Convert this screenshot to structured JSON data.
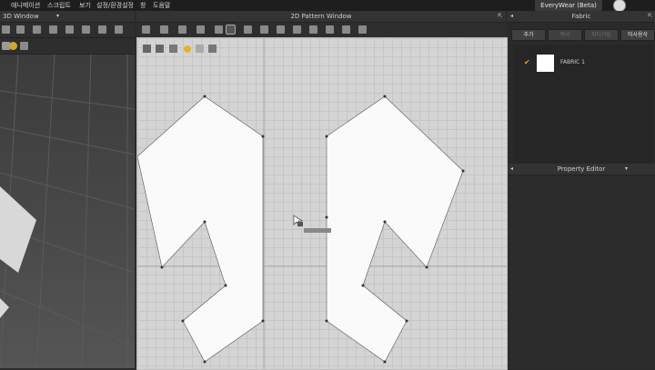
{
  "menubar": {
    "items": [
      "애니메이션",
      "스크립트",
      "보기",
      "설정/환경설정",
      "창",
      "도움말"
    ],
    "app_button": "EveryWear (Beta)"
  },
  "window3d": {
    "title": "3D Window"
  },
  "pattern_window": {
    "title": "2D Pattern Window"
  },
  "fabric_panel": {
    "title": "Fabric",
    "buttons": {
      "add": "추가",
      "b2": "복사",
      "b3": "퍼티가림",
      "b4": "미사용삭"
    },
    "items": [
      {
        "label": "FABRIC 1",
        "checked": true,
        "swatch": "#ffffff"
      }
    ]
  },
  "property_editor": {
    "title": "Property Editor"
  },
  "colors": {
    "pattern_bg": "#d4d4d4",
    "panel_bg": "#2a2a2a",
    "check_color": "#e8a31b"
  }
}
